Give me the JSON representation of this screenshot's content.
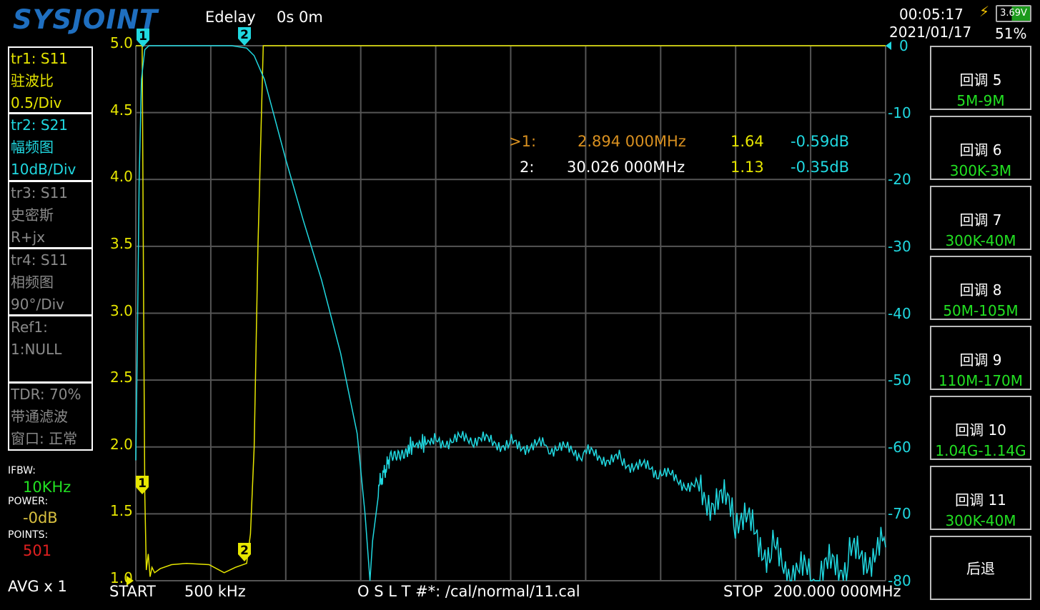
{
  "header": {
    "logo": "SYSJOINT",
    "edelay_label": "Edelay",
    "edelay_value": "0s 0m",
    "time": "00:05:17",
    "date": "2021/01/17",
    "battery_voltage": "3.69V",
    "battery_percent": "51%",
    "battery_level": 0.51,
    "charging_icon": "lightning-icon"
  },
  "traces": [
    {
      "line1": "tr1:   S11",
      "line2": "驻波比",
      "line3": "0.5/Div"
    },
    {
      "line1": "tr2:   S21",
      "line2": "幅频图",
      "line3": "10dB/Div"
    },
    {
      "line1": "tr3:   S11",
      "line2": "史密斯",
      "line3": "R+jx"
    },
    {
      "line1": "tr4:   S11",
      "line2": "相频图",
      "line3": "90°/Div"
    },
    {
      "line1": "Ref1:",
      "line2": "1:NULL",
      "line3": ""
    },
    {
      "line1": "TDR: 70%",
      "line2": "带通滤波",
      "line3": "窗口: 正常"
    }
  ],
  "settings": {
    "ifbw_label": "IFBW:",
    "ifbw_value": "10KHz",
    "power_label": "POWER:",
    "power_value": "-0dB",
    "points_label": "POINTS:",
    "points_value": "501",
    "avg": "AVG x 1"
  },
  "markers": {
    "m1": {
      "label": ">1:",
      "freq": "2.894 000MHz",
      "swr": "1.64",
      "db": "-0.59dB"
    },
    "m2": {
      "label": "2:",
      "freq": "30.026 000MHz",
      "swr": "1.13",
      "db": "-0.35dB"
    }
  },
  "footer": {
    "start_label": "START",
    "start_value": "500 kHz",
    "cal": "O S L T #*: /cal/normal/11.cal",
    "stop_label": "STOP",
    "stop_value": "200.000 000MHz"
  },
  "menu": [
    {
      "title": "回调 5",
      "sub": "5M-9M"
    },
    {
      "title": "回调 6",
      "sub": "300K-3M"
    },
    {
      "title": "回调 7",
      "sub": "300K-40M"
    },
    {
      "title": "回调 8",
      "sub": "50M-105M"
    },
    {
      "title": "回调 9",
      "sub": "110M-170M"
    },
    {
      "title": "回调 10",
      "sub": "1.04G-1.14G"
    },
    {
      "title": "回调 11",
      "sub": "300K-40M"
    },
    {
      "title": "后退"
    }
  ],
  "chart_data": {
    "type": "line",
    "x_range_mhz": [
      0.5,
      200
    ],
    "grid": true,
    "left_axis": {
      "label": "SWR",
      "ticks": [
        "5.0",
        "4.5",
        "4.0",
        "3.5",
        "3.0",
        "2.5",
        "2.0",
        "1.5",
        "1.0"
      ],
      "range": [
        1.0,
        5.0
      ]
    },
    "right_axis": {
      "label": "dB",
      "ticks": [
        "0",
        "-10",
        "-20",
        "-30",
        "-40",
        "-50",
        "-60",
        "-70",
        "-80"
      ],
      "range": [
        -80,
        0
      ]
    },
    "series": [
      {
        "name": "tr1 S11 SWR",
        "axis": "left",
        "color": "#e6e600",
        "x": [
          0.5,
          2.2,
          2.6,
          2.894,
          3.3,
          3.8,
          4.3,
          4.8,
          5.5,
          7,
          10,
          14,
          20,
          24,
          27,
          30,
          31,
          32,
          33,
          34.4,
          200
        ],
        "y": [
          5,
          5,
          3.0,
          1.64,
          1.08,
          1.2,
          1.03,
          1.1,
          1.06,
          1.09,
          1.12,
          1.13,
          1.12,
          1.06,
          1.1,
          1.13,
          1.35,
          2.0,
          3.5,
          5,
          5
        ]
      },
      {
        "name": "tr2 S21 dB",
        "axis": "right",
        "color": "#20d8e0",
        "x": [
          0.5,
          0.9,
          1.4,
          2.0,
          2.894,
          4,
          10,
          20,
          26,
          30,
          32,
          34.7,
          40.4,
          45,
          49.9,
          55,
          59.4,
          61.5,
          62.8,
          63.5,
          65,
          68,
          73,
          80,
          90,
          100,
          110,
          120,
          130,
          140,
          150,
          160,
          170,
          180,
          190,
          200
        ],
        "y": [
          -62,
          -45,
          -20,
          -5,
          -0.59,
          0,
          0,
          0,
          0,
          -0.35,
          -1.5,
          -5,
          -17,
          -26,
          -35,
          -46,
          -58,
          -70,
          -80,
          -74,
          -66,
          -62,
          -60,
          -59,
          -59,
          -59.5,
          -60,
          -61,
          -62,
          -64,
          -66,
          -70,
          -76,
          -80,
          -77,
          -75
        ]
      }
    ]
  }
}
